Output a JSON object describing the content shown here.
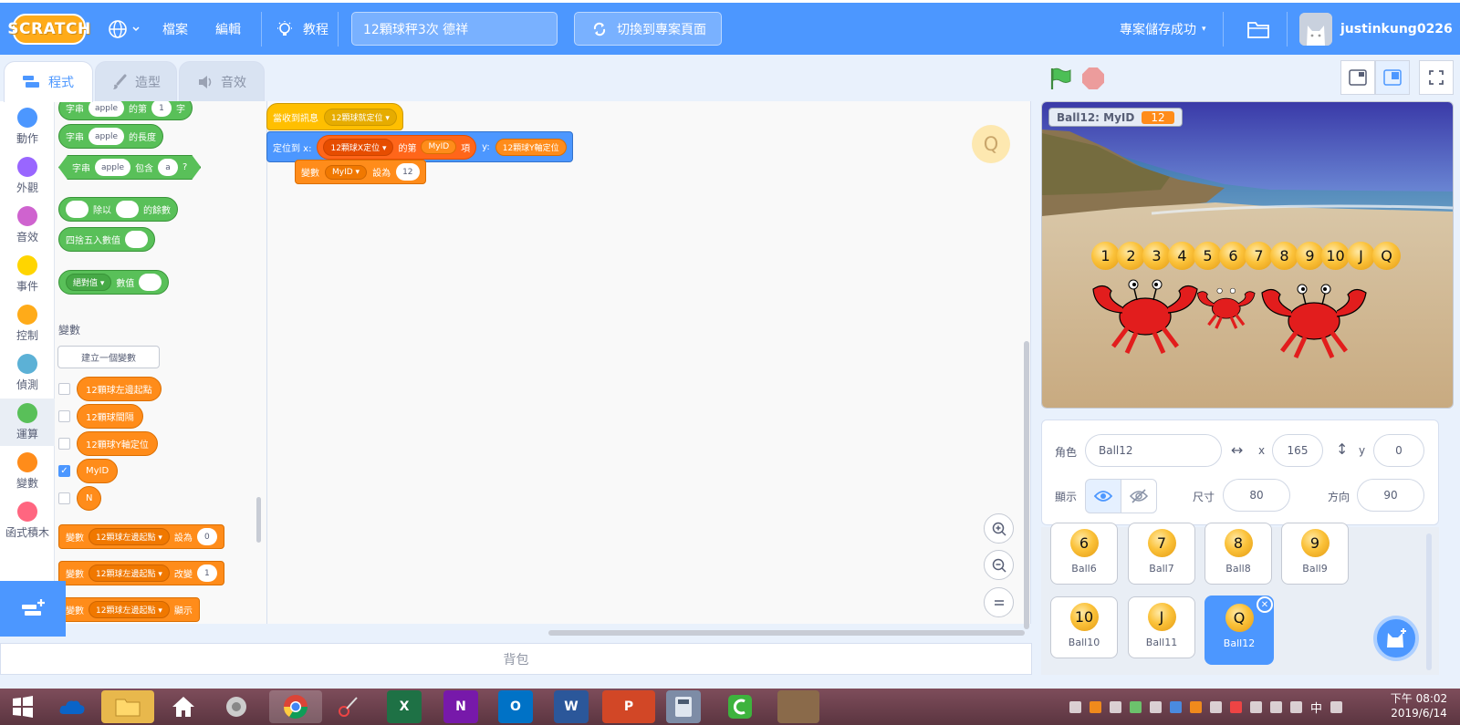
{
  "menubar": {
    "logo": "SCRATCH",
    "file": "檔案",
    "edit": "編輯",
    "tutorials": "教程",
    "project_title": "12顆球秤3次 德祥",
    "switch_label": "切換到專案頁面",
    "save_status": "專案儲存成功",
    "username": "justinkung0226"
  },
  "tabs": [
    "程式",
    "造型",
    "音效"
  ],
  "categories": [
    {
      "label": "動作",
      "color": "#4c97ff"
    },
    {
      "label": "外觀",
      "color": "#9966ff"
    },
    {
      "label": "音效",
      "color": "#cf63cf"
    },
    {
      "label": "事件",
      "color": "#ffd500"
    },
    {
      "label": "控制",
      "color": "#ffab19"
    },
    {
      "label": "偵測",
      "color": "#5cb1d6"
    },
    {
      "label": "運算",
      "color": "#59c059"
    },
    {
      "label": "變數",
      "color": "#ff8c1a"
    },
    {
      "label": "函式積木",
      "color": "#ff6680"
    }
  ],
  "palette": {
    "op_letter": {
      "a": "字串",
      "s1": "apple",
      "b": "的第",
      "s2": "1",
      "c": "字"
    },
    "op_length": {
      "a": "字串",
      "s1": "apple",
      "b": "的長度"
    },
    "op_contains": {
      "a": "字串",
      "s1": "apple",
      "b": "包含",
      "s2": "a",
      "c": "?"
    },
    "op_mod": {
      "a": "除以",
      "b": "的餘數"
    },
    "op_round": {
      "a": "四捨五入數值"
    },
    "op_abs": {
      "drop": "絕對值",
      "a": "數值"
    },
    "var_heading": "變數",
    "make_var": "建立一個變數",
    "variables": [
      "12顆球左邊起點",
      "12顆球間隔",
      "12顆球Y軸定位",
      "MyID",
      "N"
    ],
    "set_block": {
      "a": "變數",
      "drop": "12顆球左邊起點",
      "b": "設為",
      "v": "0"
    },
    "change_block": {
      "a": "變數",
      "drop": "12顆球左邊起點",
      "b": "改變",
      "v": "1"
    },
    "show_block": {
      "a": "變數",
      "drop": "12顆球左邊起點",
      "b": "顯示"
    }
  },
  "script": {
    "hat": {
      "label": "當收到訊息",
      "drop": "12顆球就定位"
    },
    "goto": {
      "label": "定位到 x:",
      "list": "12顆球X定位",
      "of": "的第",
      "item": "MyID",
      "item_suffix": "項",
      "y_label": "y:",
      "y_var": "12顆球Y軸定位"
    },
    "setvar": {
      "label": "變數",
      "drop": "MyID",
      "to": "設為",
      "value": "12"
    }
  },
  "workspace_sprite_letter": "Q",
  "backpack": "背包",
  "stage": {
    "monitor_label": "Ball12: MyID",
    "monitor_value": "12",
    "balls": [
      "1",
      "2",
      "3",
      "4",
      "5",
      "6",
      "7",
      "8",
      "9",
      "10",
      "J",
      "Q"
    ]
  },
  "sprite_info": {
    "sprite_label": "角色",
    "sprite_name": "Ball12",
    "x_label": "x",
    "x": "165",
    "y_label": "y",
    "y": "0",
    "show_label": "顯示",
    "size_label": "尺寸",
    "size": "80",
    "direction_label": "方向",
    "direction": "90"
  },
  "sprites": [
    {
      "glyph": "6",
      "name": "Ball6"
    },
    {
      "glyph": "7",
      "name": "Ball7"
    },
    {
      "glyph": "8",
      "name": "Ball8"
    },
    {
      "glyph": "9",
      "name": "Ball9"
    },
    {
      "glyph": "10",
      "name": "Ball10"
    },
    {
      "glyph": "J",
      "name": "Ball11"
    },
    {
      "glyph": "Q",
      "name": "Ball12"
    }
  ],
  "taskbar": {
    "apps": [
      "windows",
      "onedrive",
      "explorer",
      "home",
      "speaker",
      "chrome",
      "snip",
      "excel",
      "onenote",
      "outlook",
      "word",
      "powerpoint",
      "calculator",
      "camtasia",
      "game"
    ],
    "ime": "中",
    "time": "下午 08:02",
    "date": "2019/6/14"
  },
  "colors": {
    "menu_blue": "#4c97ff",
    "operators_green": "#59c059",
    "variables_orange": "#ff8c1a",
    "events_yellow": "#ffbf00",
    "motion_blue": "#4c97ff"
  }
}
